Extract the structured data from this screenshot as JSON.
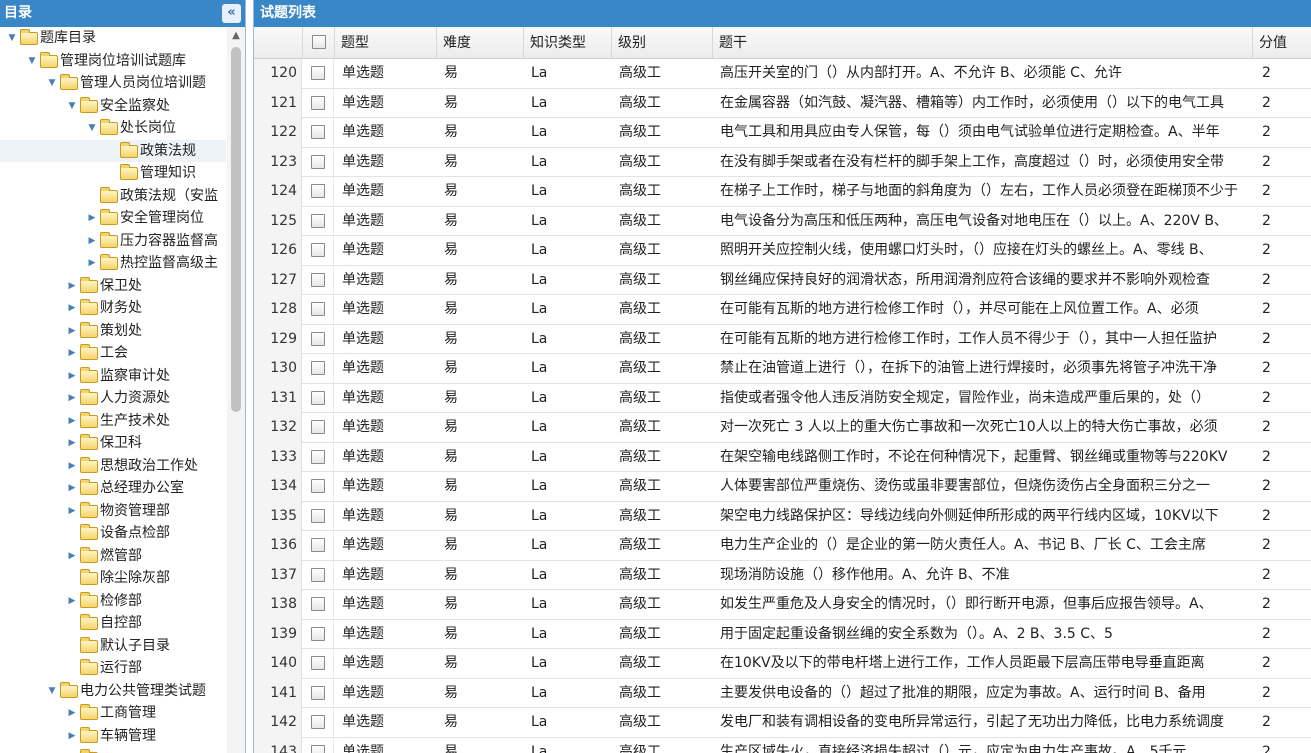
{
  "left_panel": {
    "title": "目录",
    "collapse_icon": "double-chevron-left-icon"
  },
  "tree": [
    {
      "label": "题库目录",
      "level": 0,
      "state": "open"
    },
    {
      "label": "管理岗位培训试题库",
      "level": 1,
      "state": "open"
    },
    {
      "label": "管理人员岗位培训题",
      "level": 2,
      "state": "open"
    },
    {
      "label": "安全监察处",
      "level": 3,
      "state": "open"
    },
    {
      "label": "处长岗位",
      "level": 4,
      "state": "open"
    },
    {
      "label": "政策法规",
      "level": 5,
      "state": "leaf",
      "selected": true
    },
    {
      "label": "管理知识",
      "level": 5,
      "state": "leaf"
    },
    {
      "label": "政策法规（安监",
      "level": 4,
      "state": "leaf"
    },
    {
      "label": "安全管理岗位",
      "level": 4,
      "state": "closed"
    },
    {
      "label": "压力容器监督高",
      "level": 4,
      "state": "closed"
    },
    {
      "label": "热控监督高级主",
      "level": 4,
      "state": "closed"
    },
    {
      "label": "保卫处",
      "level": 3,
      "state": "closed"
    },
    {
      "label": "财务处",
      "level": 3,
      "state": "closed"
    },
    {
      "label": "策划处",
      "level": 3,
      "state": "closed"
    },
    {
      "label": "工会",
      "level": 3,
      "state": "closed"
    },
    {
      "label": "监察审计处",
      "level": 3,
      "state": "closed"
    },
    {
      "label": "人力资源处",
      "level": 3,
      "state": "closed"
    },
    {
      "label": "生产技术处",
      "level": 3,
      "state": "closed"
    },
    {
      "label": "保卫科",
      "level": 3,
      "state": "closed"
    },
    {
      "label": "思想政治工作处",
      "level": 3,
      "state": "closed"
    },
    {
      "label": "总经理办公室",
      "level": 3,
      "state": "closed"
    },
    {
      "label": "物资管理部",
      "level": 3,
      "state": "closed"
    },
    {
      "label": "设备点检部",
      "level": 3,
      "state": "leaf"
    },
    {
      "label": "燃管部",
      "level": 3,
      "state": "closed"
    },
    {
      "label": "除尘除灰部",
      "level": 3,
      "state": "leaf"
    },
    {
      "label": "检修部",
      "level": 3,
      "state": "closed"
    },
    {
      "label": "自控部",
      "level": 3,
      "state": "leaf"
    },
    {
      "label": "默认子目录",
      "level": 3,
      "state": "leaf"
    },
    {
      "label": "运行部",
      "level": 3,
      "state": "leaf"
    },
    {
      "label": "电力公共管理类试题",
      "level": 2,
      "state": "open"
    },
    {
      "label": "工商管理",
      "level": 3,
      "state": "closed"
    },
    {
      "label": "车辆管理",
      "level": 3,
      "state": "closed"
    },
    {
      "label": "",
      "level": 3,
      "state": "closed"
    }
  ],
  "right_panel": {
    "title": "试题列表",
    "columns": {
      "type": "题型",
      "difficulty": "难度",
      "knowledge": "知识类型",
      "level": "级别",
      "stem": "题干",
      "score": "分值"
    }
  },
  "rows": [
    {
      "num": "120",
      "type": "单选题",
      "difficulty": "易",
      "knowledge": "La",
      "level": "高级工",
      "stem": "高压开关室的门（）从内部打开。A、不允许 B、必须能 C、允许",
      "score": "2"
    },
    {
      "num": "121",
      "type": "单选题",
      "difficulty": "易",
      "knowledge": "La",
      "level": "高级工",
      "stem": "在金属容器（如汽鼓、凝汽器、槽箱等）内工作时，必须使用（）以下的电气工具",
      "score": "2"
    },
    {
      "num": "122",
      "type": "单选题",
      "difficulty": "易",
      "knowledge": "La",
      "level": "高级工",
      "stem": "电气工具和用具应由专人保管，每（）须由电气试验单位进行定期检查。A、半年",
      "score": "2"
    },
    {
      "num": "123",
      "type": "单选题",
      "difficulty": "易",
      "knowledge": "La",
      "level": "高级工",
      "stem": "在没有脚手架或者在没有栏杆的脚手架上工作，高度超过（）时，必须使用安全带",
      "score": "2"
    },
    {
      "num": "124",
      "type": "单选题",
      "difficulty": "易",
      "knowledge": "La",
      "level": "高级工",
      "stem": "在梯子上工作时，梯子与地面的斜角度为（）左右，工作人员必须登在距梯顶不少于",
      "score": "2"
    },
    {
      "num": "125",
      "type": "单选题",
      "difficulty": "易",
      "knowledge": "La",
      "level": "高级工",
      "stem": "电气设备分为高压和低压两种，高压电气设备对地电压在（）以上。A、220V B、",
      "score": "2"
    },
    {
      "num": "126",
      "type": "单选题",
      "difficulty": "易",
      "knowledge": "La",
      "level": "高级工",
      "stem": "照明开关应控制火线，使用螺口灯头时，（）应接在灯头的螺丝上。A、零线 B、",
      "score": "2"
    },
    {
      "num": "127",
      "type": "单选题",
      "difficulty": "易",
      "knowledge": "La",
      "level": "高级工",
      "stem": "钢丝绳应保持良好的润滑状态，所用润滑剂应符合该绳的要求并不影响外观检查",
      "score": "2"
    },
    {
      "num": "128",
      "type": "单选题",
      "difficulty": "易",
      "knowledge": "La",
      "level": "高级工",
      "stem": "在可能有瓦斯的地方进行检修工作时（），并尽可能在上风位置工作。A、必须",
      "score": "2"
    },
    {
      "num": "129",
      "type": "单选题",
      "difficulty": "易",
      "knowledge": "La",
      "level": "高级工",
      "stem": "在可能有瓦斯的地方进行检修工作时，工作人员不得少于（），其中一人担任监护",
      "score": "2"
    },
    {
      "num": "130",
      "type": "单选题",
      "difficulty": "易",
      "knowledge": "La",
      "level": "高级工",
      "stem": "禁止在油管道上进行（），在拆下的油管上进行焊接时，必须事先将管子冲洗干净",
      "score": "2"
    },
    {
      "num": "131",
      "type": "单选题",
      "difficulty": "易",
      "knowledge": "La",
      "level": "高级工",
      "stem": "指使或者强令他人违反消防安全规定，冒险作业，尚未造成严重后果的，处（）",
      "score": "2"
    },
    {
      "num": "132",
      "type": "单选题",
      "difficulty": "易",
      "knowledge": "La",
      "level": "高级工",
      "stem": "对一次死亡 3 人以上的重大伤亡事故和一次死亡10人以上的特大伤亡事故，必须",
      "score": "2"
    },
    {
      "num": "133",
      "type": "单选题",
      "difficulty": "易",
      "knowledge": "La",
      "level": "高级工",
      "stem": "在架空输电线路侧工作时，不论在何种情况下，起重臂、钢丝绳或重物等与220KV",
      "score": "2"
    },
    {
      "num": "134",
      "type": "单选题",
      "difficulty": "易",
      "knowledge": "La",
      "level": "高级工",
      "stem": "人体要害部位严重烧伤、烫伤或虽非要害部位，但烧伤烫伤占全身面积三分之一",
      "score": "2"
    },
    {
      "num": "135",
      "type": "单选题",
      "difficulty": "易",
      "knowledge": "La",
      "level": "高级工",
      "stem": "架空电力线路保护区：导线边线向外侧延伸所形成的两平行线内区域，10KV以下",
      "score": "2"
    },
    {
      "num": "136",
      "type": "单选题",
      "difficulty": "易",
      "knowledge": "La",
      "level": "高级工",
      "stem": "电力生产企业的（）是企业的第一防火责任人。A、书记 B、厂长 C、工会主席",
      "score": "2"
    },
    {
      "num": "137",
      "type": "单选题",
      "difficulty": "易",
      "knowledge": "La",
      "level": "高级工",
      "stem": "现场消防设施（）移作他用。A、允许 B、不准",
      "score": "2"
    },
    {
      "num": "138",
      "type": "单选题",
      "difficulty": "易",
      "knowledge": "La",
      "level": "高级工",
      "stem": "如发生严重危及人身安全的情况时，（）即行断开电源，但事后应报告领导。A、",
      "score": "2"
    },
    {
      "num": "139",
      "type": "单选题",
      "difficulty": "易",
      "knowledge": "La",
      "level": "高级工",
      "stem": "用于固定起重设备钢丝绳的安全系数为（）。A、2 B、3.5 C、5",
      "score": "2"
    },
    {
      "num": "140",
      "type": "单选题",
      "difficulty": "易",
      "knowledge": "La",
      "level": "高级工",
      "stem": "在10KV及以下的带电杆塔上进行工作，工作人员距最下层高压带电导垂直距离",
      "score": "2"
    },
    {
      "num": "141",
      "type": "单选题",
      "difficulty": "易",
      "knowledge": "La",
      "level": "高级工",
      "stem": "主要发供电设备的（）超过了批准的期限，应定为事故。A、运行时间 B、备用",
      "score": "2"
    },
    {
      "num": "142",
      "type": "单选题",
      "difficulty": "易",
      "knowledge": "La",
      "level": "高级工",
      "stem": "发电厂和装有调相设备的变电所异常运行，引起了无功出力降低，比电力系统调度",
      "score": "2"
    },
    {
      "num": "143",
      "type": "单选题",
      "difficulty": "易",
      "knowledge": "La",
      "level": "高级工",
      "stem": "生产区域失火，直接经济损失超过（）元，应定为电力生产事故。A、5千元",
      "score": "2"
    }
  ],
  "colors": {
    "header_bar": "#3a87c8",
    "panel_border": "#95b8e7",
    "folder": "#f5d36a"
  }
}
